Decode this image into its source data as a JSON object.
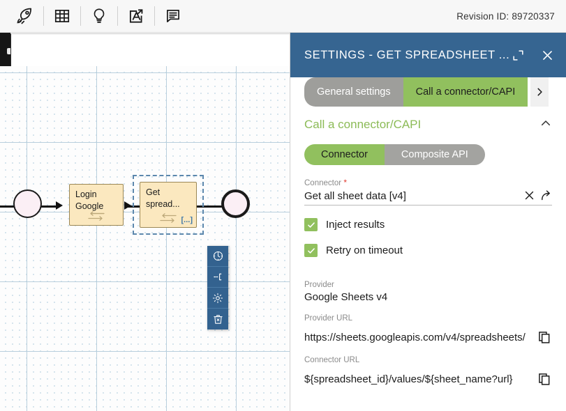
{
  "toolbar": {
    "icons": [
      {
        "name": "rocket-icon",
        "label": "Deploy"
      },
      {
        "name": "grid-icon",
        "label": "Data grid"
      },
      {
        "name": "lightbulb-icon",
        "label": "Ideas"
      },
      {
        "name": "pdf-export-icon",
        "label": "Export PDF"
      },
      {
        "name": "document-icon",
        "label": "Documentation"
      }
    ],
    "revision_label": "Revision ID: 89720337"
  },
  "canvas": {
    "start_event": "start-event",
    "end_event": "end-event",
    "tasks": [
      {
        "label": "Login Google",
        "icon": "service-task-icon",
        "selected": false
      },
      {
        "label": "Get spread...",
        "icon": "service-task-icon",
        "marker": "[...]",
        "selected": true
      }
    ],
    "context_pad": [
      {
        "name": "timer-icon",
        "label": "Attach timer"
      },
      {
        "name": "boundary-event-icon",
        "label": "Attach event"
      },
      {
        "name": "gear-icon",
        "label": "Settings"
      },
      {
        "name": "trash-icon",
        "label": "Delete"
      }
    ]
  },
  "panel": {
    "header": {
      "title": "SETTINGS  -  GET SPREADSHEET ...",
      "maximize_icon": "maximize-icon",
      "close_icon": "close-icon"
    },
    "tabs": [
      {
        "label": "General settings",
        "active": false
      },
      {
        "label": "Call a connector/CAPI",
        "active": true
      }
    ],
    "tab_scroll_icon": "chevron-right-icon",
    "section": {
      "title": "Call a connector/CAPI",
      "collapse_icon": "chevron-up-icon"
    },
    "segmented": {
      "options": [
        "Connector",
        "Composite API"
      ],
      "selected": "Connector"
    },
    "connector_field": {
      "label": "Connector",
      "required": true,
      "value": "Get all sheet data [v4]",
      "clear_icon": "close-icon",
      "open_icon": "arrow-forward-icon"
    },
    "checkboxes": [
      {
        "label": "Inject results",
        "checked": true
      },
      {
        "label": "Retry on timeout",
        "checked": true
      }
    ],
    "readonly_fields": [
      {
        "label": "Provider",
        "value": "Google Sheets v4",
        "copy": false
      },
      {
        "label": "Provider URL",
        "value": "https://sheets.googleapis.com/v4/spreadsheets/",
        "copy": true
      },
      {
        "label": "Connector URL",
        "value": "${spreadsheet_id}/values/${sheet_name?url}",
        "copy": true
      }
    ]
  },
  "colors": {
    "header_blue": "#366591",
    "accent_green": "#91c05e",
    "tab_gray": "#9e9e9b",
    "task_fill": "#fbe8bf",
    "context_pad": "#33628f"
  }
}
